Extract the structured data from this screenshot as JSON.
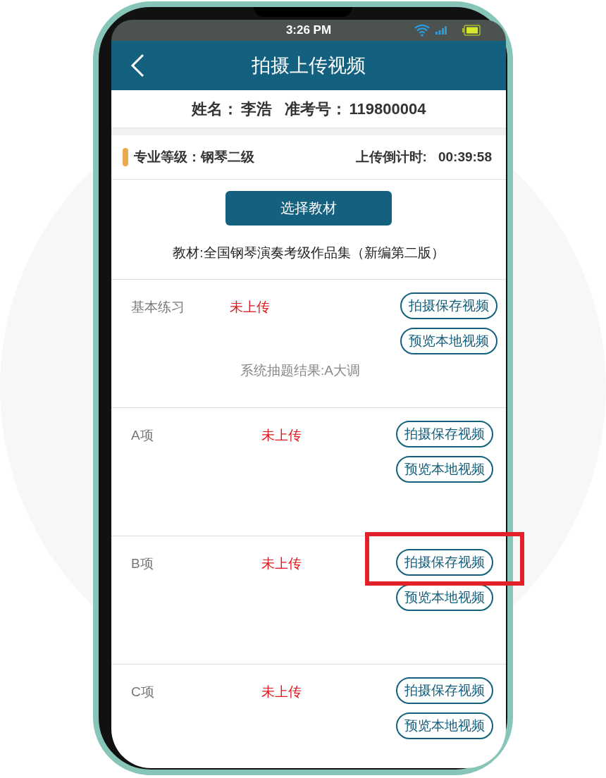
{
  "status_bar": {
    "time": "3:26 PM"
  },
  "header": {
    "title": "拍摄上传视频"
  },
  "candidate": {
    "name_label": "姓名：",
    "name": "李浩",
    "id_label": "准考号：",
    "id": "119800004"
  },
  "grade": {
    "label": "专业等级：",
    "value": "钢琴二级",
    "countdown_label": "上传倒计时:",
    "countdown": "00:39:58"
  },
  "choose_button": "选择教材",
  "textbook": "教材:全国钢琴演奏考级作品集（新编第二版）",
  "items": [
    {
      "label": "基本练习",
      "status": "未上传",
      "capture": "拍摄保存视频",
      "preview": "预览本地视频",
      "note": "系统抽题结果:A大调",
      "highlighted": false
    },
    {
      "label": "A项",
      "status": "未上传",
      "capture": "拍摄保存视频",
      "preview": "预览本地视频",
      "highlighted": false
    },
    {
      "label": "B项",
      "status": "未上传",
      "capture": "拍摄保存视频",
      "preview": "预览本地视频",
      "highlighted": true
    },
    {
      "label": "C项",
      "status": "未上传",
      "capture": "拍摄保存视频",
      "preview": "预览本地视频",
      "highlighted": false
    }
  ]
}
